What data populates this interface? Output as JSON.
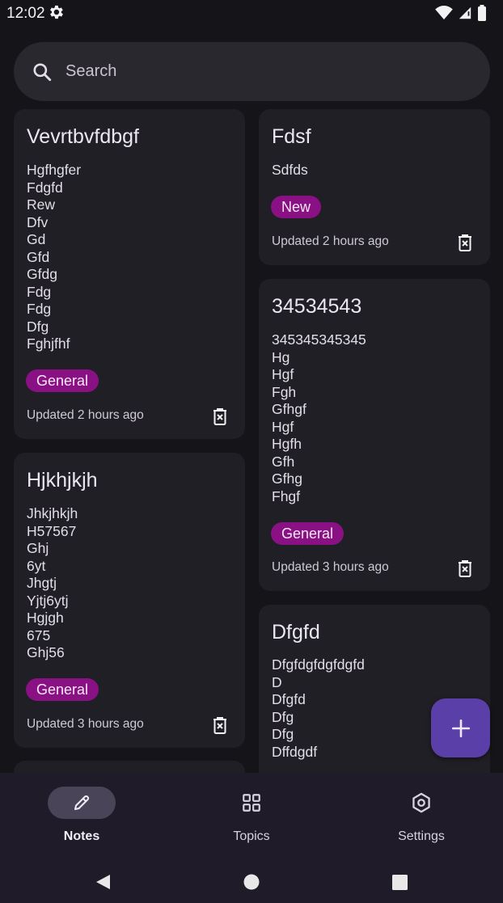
{
  "status_bar": {
    "time": "12:02"
  },
  "search": {
    "placeholder": "Search"
  },
  "notes": [
    {
      "title": "Vevrtbvfdbgf",
      "body": "Hgfhgfer\nFdgfd\nRew\nDfv\nGd\nGfd\nGfdg\nFdg\nFdg\nDfg\nFghjfhf",
      "tag": "General",
      "updated": "Updated 2 hours ago"
    },
    {
      "title": "Fdsf",
      "body": "Sdfds",
      "tag": "New",
      "updated": "Updated 2 hours ago"
    },
    {
      "title": "34534543",
      "body": "345345345345\nHg\nHgf\nFgh\nGfhgf\nHgf\nHgfh\nGfh\nGfhg\nFhgf",
      "tag": "General",
      "updated": "Updated 3 hours ago"
    },
    {
      "title": "Hjkhjkjh",
      "body": "Jhkjhkjh\nH57567\nGhj\n6yt\nJhgtj\nYjtj6ytj\nHgjgh\n675\nGhj56",
      "tag": "General",
      "updated": "Updated 3 hours ago"
    },
    {
      "title": "Dfgfd",
      "body": "Dfgfdgfdgfdgfd\nD\nDfgfd\nDfg\nDfg\nDffdgdf"
    }
  ],
  "nav": {
    "items": [
      {
        "label": "Notes",
        "icon": "pencil-icon",
        "active": true
      },
      {
        "label": "Topics",
        "icon": "grid-icon",
        "active": false
      },
      {
        "label": "Settings",
        "icon": "settings-hex-icon",
        "active": false
      }
    ]
  },
  "colors": {
    "accent": "#8a1184",
    "fab": "#5b3fa8",
    "card": "#211f26",
    "background": "#151419"
  }
}
